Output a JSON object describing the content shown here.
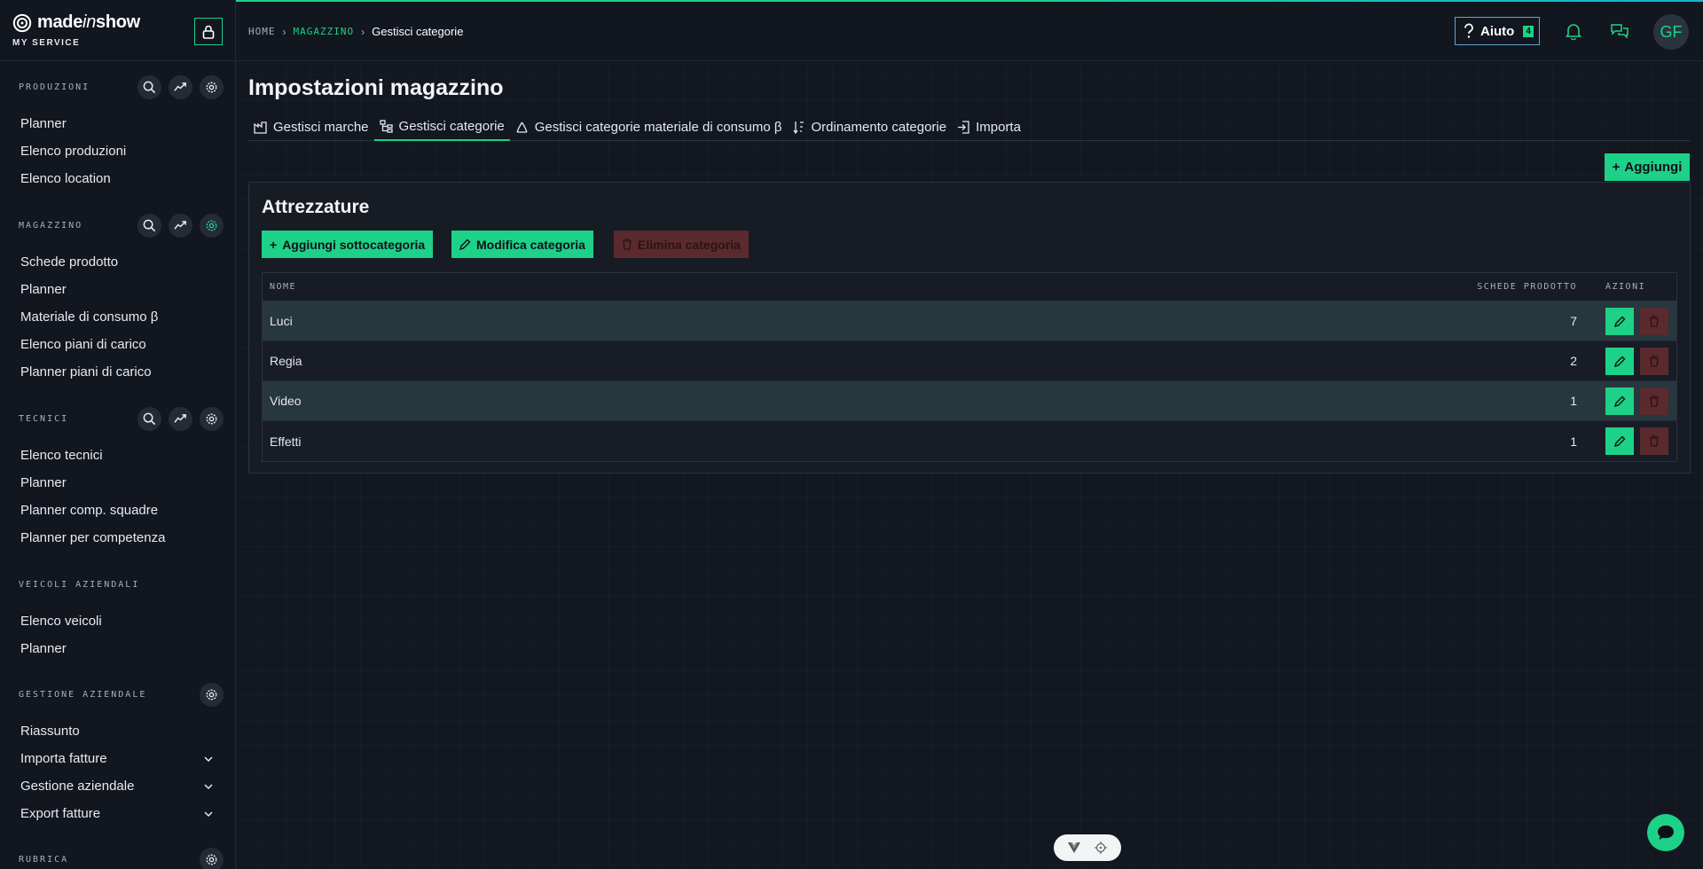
{
  "brand": {
    "name_pre": "made",
    "name_mid": "in",
    "name_post": "show",
    "subtitle": "MY SERVICE"
  },
  "sidebar": {
    "sections": [
      {
        "title": "PRODUZIONI",
        "items": [
          "Planner",
          "Elenco produzioni",
          "Elenco location"
        ]
      },
      {
        "title": "MAGAZZINO",
        "items": [
          "Schede prodotto",
          "Planner",
          "Materiale di consumo β",
          "Elenco piani di carico",
          "Planner piani di carico"
        ]
      },
      {
        "title": "TECNICI",
        "items": [
          "Elenco tecnici",
          "Planner",
          "Planner comp. squadre",
          "Planner per competenza"
        ]
      },
      {
        "title": "VEICOLI AZIENDALI",
        "items": [
          "Elenco veicoli",
          "Planner"
        ]
      },
      {
        "title": "GESTIONE AZIENDALE",
        "items": [
          "Riassunto",
          "Importa fatture",
          "Gestione aziendale",
          "Export fatture"
        ]
      },
      {
        "title": "RUBRICA",
        "items": []
      }
    ]
  },
  "breadcrumb": {
    "home": "HOME",
    "section": "MAGAZZINO",
    "current": "Gestisci categorie"
  },
  "header": {
    "help_label": "Aiuto",
    "help_count": "4",
    "avatar_initials": "GF"
  },
  "page": {
    "title": "Impostazioni magazzino",
    "tabs": [
      "Gestisci marche",
      "Gestisci categorie",
      "Gestisci categorie materiale di consumo β",
      "Ordinamento categorie",
      "Importa"
    ],
    "add_label": "Aggiungi"
  },
  "card": {
    "title": "Attrezzature",
    "buttons": {
      "add_sub": "Aggiungi sottocategoria",
      "edit": "Modifica categoria",
      "delete": "Elimina categoria"
    },
    "table": {
      "headers": {
        "name": "NOME",
        "count": "SCHEDE PRODOTTO",
        "actions": "AZIONI"
      },
      "rows": [
        {
          "name": "Luci",
          "count": "7"
        },
        {
          "name": "Regia",
          "count": "2"
        },
        {
          "name": "Video",
          "count": "1"
        },
        {
          "name": "Effetti",
          "count": "1"
        }
      ]
    }
  },
  "colors": {
    "accent": "#1ed188",
    "danger": "#5a2a2e",
    "background": "#121720"
  }
}
